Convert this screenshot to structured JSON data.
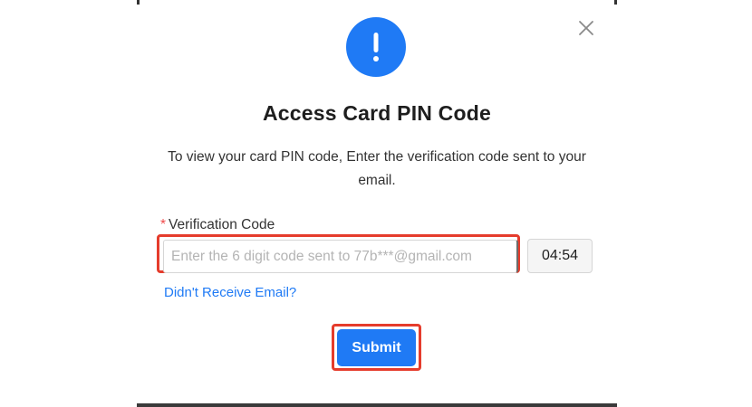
{
  "modal": {
    "title": "Access Card PIN Code",
    "description": "To view your card PIN code, Enter the verification code sent to your email.",
    "close_icon": "close-icon",
    "alert_icon": "exclamation-icon",
    "alert_symbol": "!"
  },
  "form": {
    "required_marker": "*",
    "label": "Verification Code",
    "placeholder": "Enter the 6 digit code sent to 77b***@gmail.com",
    "value": "",
    "timer": "04:54",
    "resend_link": "Didn't Receive Email?",
    "submit_label": "Submit"
  },
  "colors": {
    "accent": "#1f7af5",
    "highlight": "#e53c2c",
    "required": "#f04a4a"
  }
}
